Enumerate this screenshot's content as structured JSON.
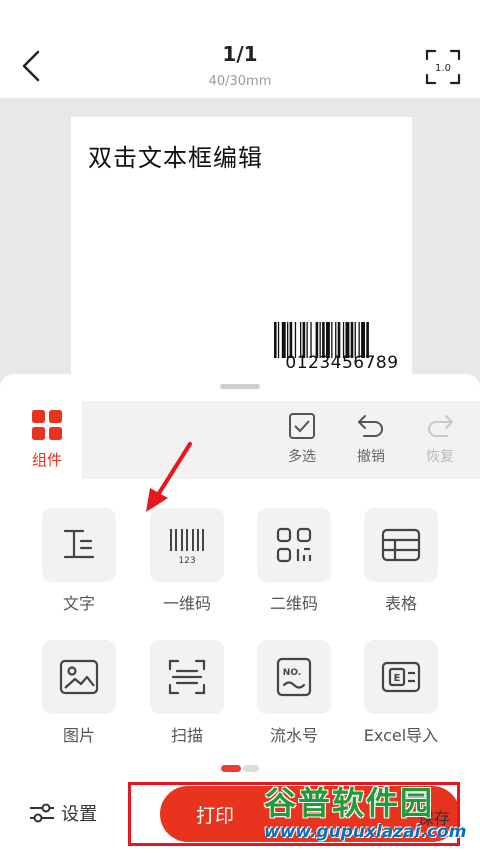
{
  "header": {
    "page_counter": "1/1",
    "label_size": "40/30mm",
    "zoom_value": "1.0"
  },
  "canvas": {
    "text_element": "双击文本框编辑",
    "barcode_value": "0123456789"
  },
  "panel": {
    "tab_components": "组件",
    "toolbar": {
      "multi_select": "多选",
      "undo": "撤销",
      "redo": "恢复"
    },
    "components": [
      {
        "label": "文字",
        "icon": "text-icon"
      },
      {
        "label": "一维码",
        "icon": "barcode-icon"
      },
      {
        "label": "二维码",
        "icon": "qrcode-icon"
      },
      {
        "label": "表格",
        "icon": "table-icon"
      },
      {
        "label": "图片",
        "icon": "image-icon"
      },
      {
        "label": "扫描",
        "icon": "scan-icon"
      },
      {
        "label": "流水号",
        "icon": "serial-number-icon"
      },
      {
        "label": "Excel导入",
        "icon": "excel-import-icon"
      }
    ],
    "page_indicator": {
      "active_index": 0,
      "total": 2
    }
  },
  "bottom": {
    "settings": "设置",
    "print": "打印",
    "save_partial": "保存"
  },
  "watermark": {
    "brand": "谷普软件园",
    "url": "www.gupuxlazai.com"
  },
  "colors": {
    "accent": "#e8331e",
    "annotation_red": "#e8161c",
    "watermark_green": "#1e9c3a",
    "watermark_blue": "#0b6fb8"
  }
}
